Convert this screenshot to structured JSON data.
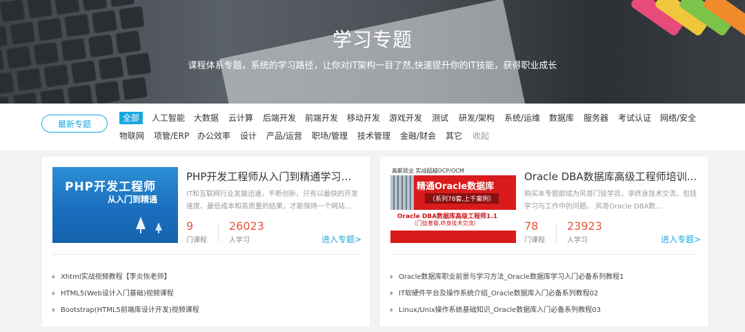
{
  "banner": {
    "title": "学习专题",
    "subtitle": "课程体系专题，系统的学习路径，让你对IT架构一目了然,快速提升你的IT技能，获得职业成长"
  },
  "filter": {
    "newest_label": "最新专题",
    "row1": [
      "全部",
      "人工智能",
      "大数据",
      "云计算",
      "后端开发",
      "前端开发",
      "移动开发",
      "游戏开发",
      "测试",
      "研发/架构",
      "系统/运维",
      "数据库",
      "服务器",
      "考试认证",
      "网络/安全"
    ],
    "row2": [
      "物联网",
      "项管/ERP",
      "办公效率",
      "设计",
      "产品/运营",
      "职场/管理",
      "技术管理",
      "金融/财会",
      "其它",
      "收起"
    ],
    "active": "全部"
  },
  "cards": [
    {
      "title": "PHP开发工程师从入门到精通学习系...",
      "desc": "IT和互联网行业发展迅速，不断创新，只有以最快的开发速度、最低成本和高质量的结果，才能保持一个网站...",
      "courses_count": "9",
      "courses_label": "门课程",
      "learners_count": "26023",
      "learners_label": "人学习",
      "enter_label": "进入专题>",
      "thumb": {
        "line1": "PHP开发工程师",
        "line2": "从入门到精通"
      },
      "courses": [
        "Xhtml实战视频教程【李炎恢老师】",
        "HTML5(Web设计入门基础)视频课程",
        "Bootstrap(HTML5前端库设计开发)视频课程"
      ]
    },
    {
      "title": "Oracle DBA数据库高级工程师培训...",
      "desc": "购买本专题即成为风哥门徒学员，享终身技术交流，包括学习与工作中的问题。 风哥Oracle DBA数...",
      "courses_count": "78",
      "courses_label": "门课程",
      "learners_count": "23923",
      "learners_label": "人学习",
      "enter_label": "进入专题>",
      "thumb": {
        "top": "高薪就业 实战超越OCP/OCM",
        "h1": "精通Oracle数据库",
        "h2": "（系列78套,上千案例）",
        "m1": "Oracle DBA数据库高级工程师1.1",
        "m2": "（门徒套餐,终身技术交流）"
      },
      "courses": [
        "Oracle数据库职业前景与学习方法_Oracle数据库学习入门必备系列教程1",
        "IT软硬件平台及操作系统介绍_Oracle数据库入门必备系列教程02",
        "Linux/Unix操作系统基础知识_Oracle数据库入门必备系列教程03"
      ]
    }
  ],
  "colors": {
    "accent": "#1aa7e0",
    "number": "#e6553a"
  }
}
